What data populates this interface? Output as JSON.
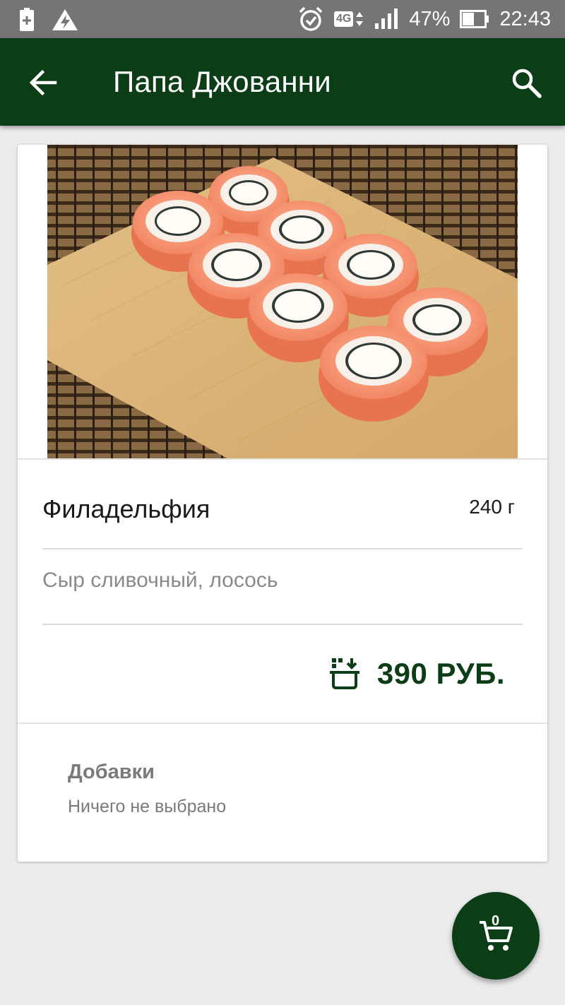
{
  "status_bar": {
    "lte": "4G",
    "battery_percent": "47%",
    "time": "22:43"
  },
  "app_bar": {
    "title": "Папа Джованни",
    "back_icon": "arrow-back-icon",
    "search_icon": "search-icon"
  },
  "product": {
    "image": "sushi-rolls-photo",
    "name": "Филадельфия",
    "weight": "240 г",
    "description": "Сыр сливочный, лосось",
    "price": "390 РУБ.",
    "price_icon": "add-to-basket-icon"
  },
  "addons": {
    "title": "Добавки",
    "value": "Ничего не выбрано"
  },
  "cart": {
    "count": "0",
    "icon": "cart-icon"
  },
  "colors": {
    "primary": "#0b3d17",
    "status_bar": "#757575",
    "background": "#ececec"
  }
}
